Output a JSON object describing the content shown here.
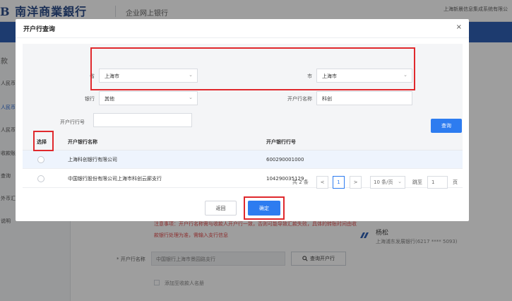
{
  "app": {
    "logo": "B 南洋商業銀行",
    "portal": "企业网上银行",
    "company": "上海新晨信息集成系统有限公"
  },
  "sidebar": {
    "items": [
      {
        "label": "款"
      },
      {
        "label": "人民币"
      },
      {
        "label": "人民币"
      },
      {
        "label": "人民币"
      },
      {
        "label": "收款账"
      },
      {
        "label": "查询"
      },
      {
        "label": "外币汇"
      },
      {
        "label": "说明"
      }
    ]
  },
  "background": {
    "warning_1": "注意事项：开户行名称需与收款人开户行一致，否则可能导致汇款失败，具体的转账时间由收",
    "warning_2": "款银行处理为准，需输入支行信息",
    "payee_name": "杨松",
    "payee_account": "上海浦东发展银行(6217 **** 5093)",
    "bank_label": "* 开户行名称",
    "bank_value": "中国银行上海市景园路支行",
    "query_bank_button": "查询开户行",
    "add_payee_label": "添加至收款人名册"
  },
  "modal": {
    "title": "开户行查询",
    "close": "×",
    "filters": {
      "province_label": "省",
      "province_value": "上海市",
      "city_label": "市",
      "city_value": "上海市",
      "bank_label": "银行",
      "bank_value": "其他",
      "branch_name_label": "开户行名称",
      "branch_name_value": "科创",
      "branch_code_label": "开户行行号",
      "branch_code_value": ""
    },
    "query_button": "查询",
    "table": {
      "headers": [
        "选择",
        "开户银行名称",
        "开户银行行号"
      ],
      "rows": [
        {
          "name": "上海科创银行有限公司",
          "code": "600290001000"
        },
        {
          "name": "中国银行股份有限公司上海市科创云廊支行",
          "code": "104290035129"
        }
      ]
    },
    "pagination": {
      "total": "共 2 条",
      "prev": "<",
      "current_page": "1",
      "next": ">",
      "page_size": "10 条/页",
      "goto_label": "跳至",
      "goto_value": "1",
      "page_unit": "页"
    },
    "back_button": "返回",
    "confirm_button": "确定"
  },
  "colors": {
    "brand_blue": "#2f5fb3",
    "primary_button": "#2d7cf0",
    "highlight_red": "#e0292d",
    "warning_text": "#e14b4b"
  }
}
